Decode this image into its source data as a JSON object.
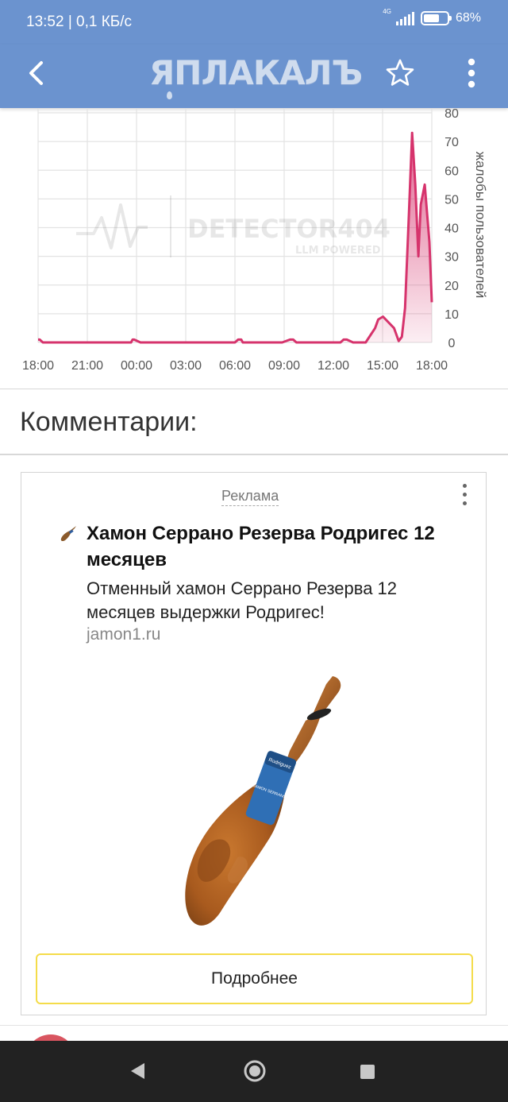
{
  "status_bar": {
    "time_speed": "13:52 | 0,1 КБ/с",
    "network": "4G",
    "battery_percent": "68%",
    "battery_level": 0.68
  },
  "app_bar": {
    "logo_text": "ЯПЛАКАЛЪ",
    "icons": [
      "back-arrow-icon",
      "star-icon",
      "more-vert-icon"
    ]
  },
  "chart_data": {
    "type": "area",
    "ylabel": "жалобы пользователей",
    "xlabel": "",
    "watermark": "DETECTOR404",
    "watermark_sub": "LLM POWERED",
    "x_tick_labels": [
      "18:00",
      "21:00",
      "00:00",
      "03:00",
      "06:00",
      "09:00",
      "12:00",
      "15:00",
      "18:00"
    ],
    "y_tick_labels": [
      "0",
      "10",
      "20",
      "30",
      "40",
      "50",
      "60",
      "70",
      "80"
    ],
    "ylim": [
      0,
      80
    ],
    "xlim_hours": [
      0,
      24
    ],
    "grid": true,
    "color": "#d6336c",
    "series": [
      {
        "x": [
          0,
          0.1,
          0.3,
          2,
          5.9,
          6,
          6.1,
          6.5,
          9,
          12.5,
          12.7,
          12.9,
          13,
          15.5,
          16,
          16.2,
          16.4,
          19.2,
          19.4,
          19.6,
          20,
          20.8,
          21.4,
          21.6,
          21.9,
          22.6,
          23.5,
          24
        ],
        "y": [
          1,
          1,
          0,
          0,
          0,
          1,
          1,
          0,
          0,
          0,
          1,
          1,
          0,
          0,
          1,
          1,
          0,
          0,
          1,
          1,
          0,
          0,
          5,
          8,
          9,
          5,
          1,
          0
        ]
      }
    ],
    "peaks": [
      {
        "x": 22.8,
        "y": 1
      },
      {
        "x": 23.3,
        "y": 6
      },
      {
        "x": 23.6,
        "y": 30
      },
      {
        "x": 24.0,
        "y": 73
      }
    ]
  },
  "comments": {
    "title": "Комментарии:"
  },
  "ad": {
    "label": "Реклама",
    "title": "Хамон Серрано Резерва Родригес 12 месяцев",
    "text": "Отменный хамон Серрано Резерва 12 месяцев выдержки Родригес!",
    "domain": "jamon1.ru",
    "button": "Подробнее",
    "image_label": "Rodriguez",
    "image_sub": "JAMON SERRANO"
  },
  "nav_bar": {
    "icons": [
      "nav-back-icon",
      "nav-home-icon",
      "nav-recent-icon"
    ]
  }
}
